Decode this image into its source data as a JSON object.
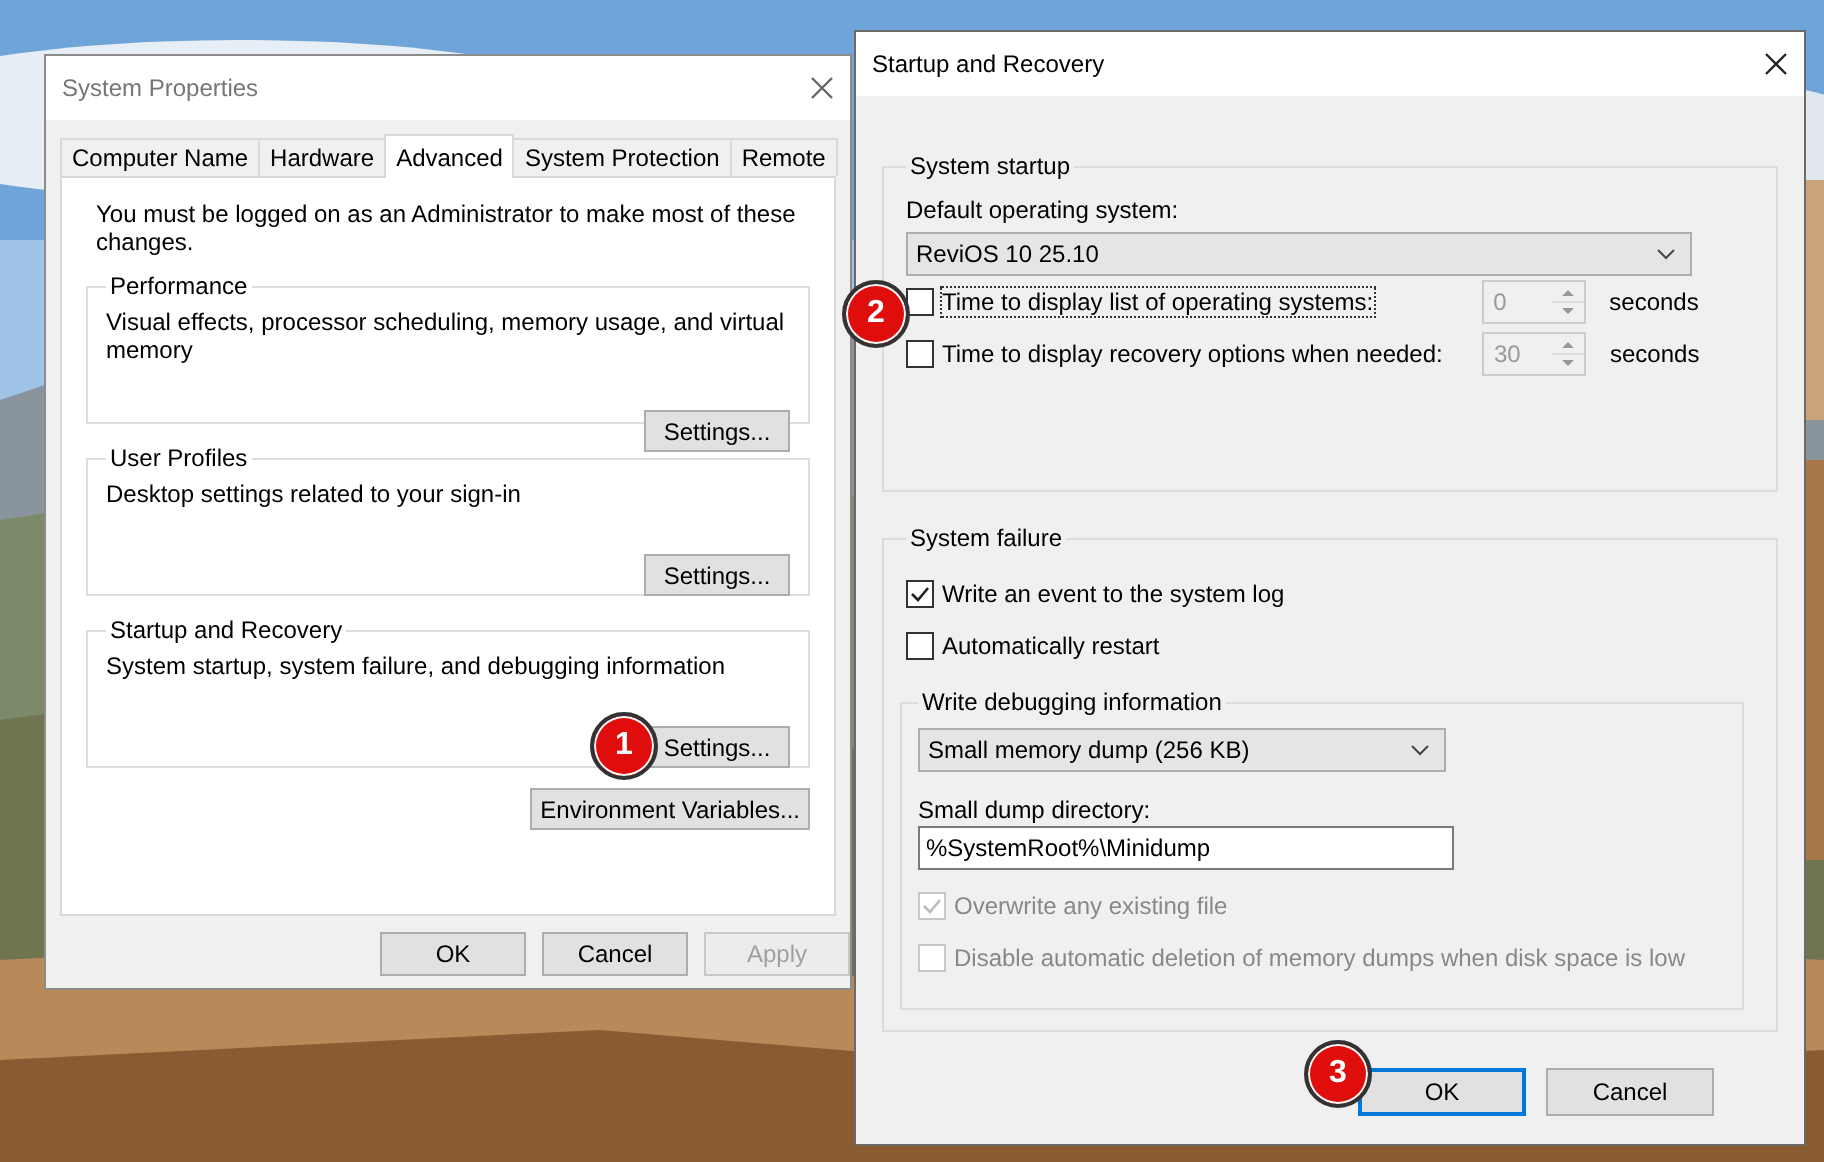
{
  "system_properties": {
    "title": "System Properties",
    "tabs": [
      {
        "label": "Computer Name",
        "selected": false
      },
      {
        "label": "Hardware",
        "selected": false
      },
      {
        "label": "Advanced",
        "selected": true
      },
      {
        "label": "System Protection",
        "selected": false
      },
      {
        "label": "Remote",
        "selected": false
      }
    ],
    "notice": "You must be logged on as an Administrator to make most of these changes.",
    "groups": [
      {
        "title": "Performance",
        "description": "Visual effects, processor scheduling, memory usage, and virtual memory",
        "button": "Settings..."
      },
      {
        "title": "User Profiles",
        "description": "Desktop settings related to your sign-in",
        "button": "Settings..."
      },
      {
        "title": "Startup and Recovery",
        "description": "System startup, system failure, and debugging information",
        "button": "Settings..."
      }
    ],
    "env_button": "Environment Variables...",
    "buttons": [
      {
        "label": "OK",
        "disabled": false
      },
      {
        "label": "Cancel",
        "disabled": false
      },
      {
        "label": "Apply",
        "disabled": true
      }
    ]
  },
  "startup_recovery": {
    "title": "Startup and Recovery",
    "system_startup": {
      "title": "System startup",
      "os_label": "Default operating system:",
      "os_value": "ReviOS 10 25.10",
      "timeouts": [
        {
          "label": "Time to display list of operating systems:",
          "checked": false,
          "focused": true,
          "value": "0",
          "unit": "seconds"
        },
        {
          "label": "Time to display recovery options when needed:",
          "checked": false,
          "focused": false,
          "value": "30",
          "unit": "seconds"
        }
      ]
    },
    "system_failure": {
      "title": "System failure",
      "options": [
        {
          "label": "Write an event to the system log",
          "checked": true
        },
        {
          "label": "Automatically restart",
          "checked": false
        }
      ],
      "debug": {
        "title": "Write debugging information",
        "dump_type": "Small memory dump (256 KB)",
        "dir_label": "Small dump directory:",
        "dir_value": "%SystemRoot%\\Minidump",
        "options": [
          {
            "label": "Overwrite any existing file",
            "checked": true,
            "disabled": true
          },
          {
            "label": "Disable automatic deletion of memory dumps when disk space is low",
            "checked": false,
            "disabled": true
          }
        ]
      }
    },
    "buttons": [
      {
        "label": "OK",
        "focused": true
      },
      {
        "label": "Cancel",
        "focused": false
      }
    ]
  },
  "step_badges": [
    {
      "label": "1"
    },
    {
      "label": "2"
    },
    {
      "label": "3"
    }
  ]
}
